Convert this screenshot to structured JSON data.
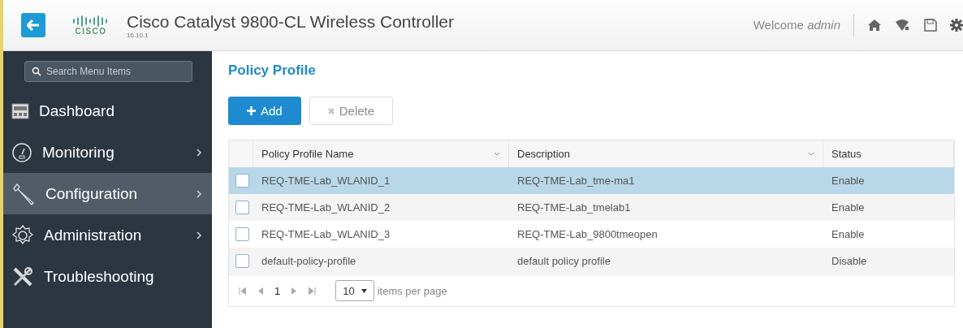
{
  "header": {
    "title": "Cisco Catalyst 9800-CL Wireless Controller",
    "version": "16.10.1",
    "logo_text": "CISCO",
    "welcome": "Welcome",
    "user": "admin"
  },
  "sidebar": {
    "search": {
      "placeholder": "Search Menu Items"
    },
    "items": [
      {
        "label": "Dashboard",
        "selected": false,
        "submenu": false
      },
      {
        "label": "Monitoring",
        "selected": false,
        "submenu": true
      },
      {
        "label": "Configuration",
        "selected": true,
        "submenu": true
      },
      {
        "label": "Administration",
        "selected": false,
        "submenu": true
      },
      {
        "label": "Troubleshooting",
        "selected": false,
        "submenu": false
      }
    ]
  },
  "page": {
    "title": "Policy Profile",
    "buttons": [
      {
        "label": "Add",
        "disabled": false,
        "kind": "add"
      },
      {
        "label": "Delete",
        "disabled": true,
        "kind": "delete"
      }
    ]
  },
  "table": {
    "columns": [
      {
        "label": "Policy Profile Name",
        "sortable": true
      },
      {
        "label": "Description",
        "sortable": true
      },
      {
        "label": "Status",
        "sortable": false
      }
    ],
    "rows": [
      {
        "selected": true,
        "checked": false,
        "cells": [
          "REQ-TME-Lab_WLANID_1",
          "REQ-TME-Lab_tme-ma1",
          "Enable"
        ]
      },
      {
        "selected": false,
        "checked": false,
        "cells": [
          "REQ-TME-Lab_WLANID_2",
          "REQ-TME-Lab_tmelab1",
          "Enable"
        ]
      },
      {
        "selected": false,
        "checked": false,
        "cells": [
          "REQ-TME-Lab_WLANID_3",
          "REQ-TME-Lab_9800tmeopen",
          "Enable"
        ]
      },
      {
        "selected": false,
        "checked": false,
        "cells": [
          "default-policy-profile",
          "default policy profile",
          "Disable"
        ]
      }
    ]
  },
  "pager": {
    "page": "1",
    "page_size": "10",
    "suffix": "items per page"
  }
}
